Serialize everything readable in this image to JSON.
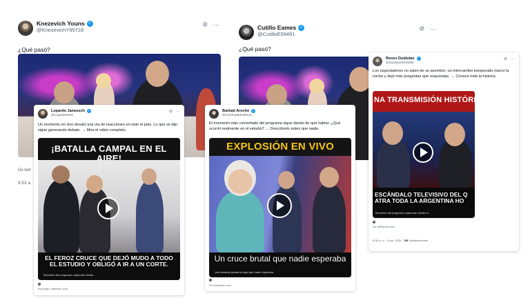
{
  "tweet_a": {
    "name": "Knezevich Youns",
    "handle": "@KnezevichY9571θ",
    "text": "¿Qué pasó?",
    "source": "De twit",
    "time": "9:53 a"
  },
  "tweet_b": {
    "name": "Cutillo Eames",
    "handle": "@CutilloE594θ1",
    "text": "¿Qué pasó?"
  },
  "card_lopardo": {
    "name": "Lopardo Janeusch",
    "handle": "@LopardoJN49",
    "text": "Un momento en vivo desató una ola de reacciones en todo el país. Lo que se dijo sigue generando debate. → Mira el video completo.",
    "headline": "¡BATALLA CAMPAL EN EL AIRE!",
    "caption": "EL FEROZ CRUCE QUE DEJÓ MUDO A TODO EL ESTUDIO Y OBLIGÓ A IR A UN CORTE.",
    "credit": "Momento del programa capturado desde ...",
    "source": "De juego: caliberen.com"
  },
  "card_barbati": {
    "name": "Barbati Arecho",
    "handle": "@ArechoBarbati9141",
    "text": "El momento más comentado del programa sigue dando de qué hablar. ¿Qué ocurrió realmente en el estudio? → Descúbrelo antes que nadie.",
    "headline": "EXPLOSIÓN EN VIVO",
    "caption": "Un cruce brutal que nadie esperaba",
    "credit": "Las cámaras grabaron algo que nadie esperaba",
    "source": "De vbflowers.com"
  },
  "card_renzo": {
    "name": "Renzo Duldulao",
    "handle": "@DuldulaoRe63282",
    "text": "Los espectadores no salen de su asombro: un intercambio inesperado marcó la noche y dejó más preguntas que respuestas. → Conoce toda la historia.",
    "headline": "NA TRANSMISIÓN HISTÓRIC",
    "caption": "ESCÁNDALO TELEVISIVO DEL Q ATRA TODA LA ARGENTINA HO",
    "credit": "Momento del programa capturado desde el...",
    "source": "De vbflowers.com",
    "time": "8:35 a. m. · 5 jun. 2026 ·",
    "views": "745",
    "views_label": "Visualizaciones"
  },
  "icons": [
    "grok-icon",
    "more-icon",
    "verified-icon",
    "play-icon"
  ],
  "colors": {
    "verified": "#1d9bf0",
    "headline_red": "#d7261e",
    "headline_yellow": "#f5c518",
    "text": "#0f1419",
    "muted": "#536471"
  }
}
